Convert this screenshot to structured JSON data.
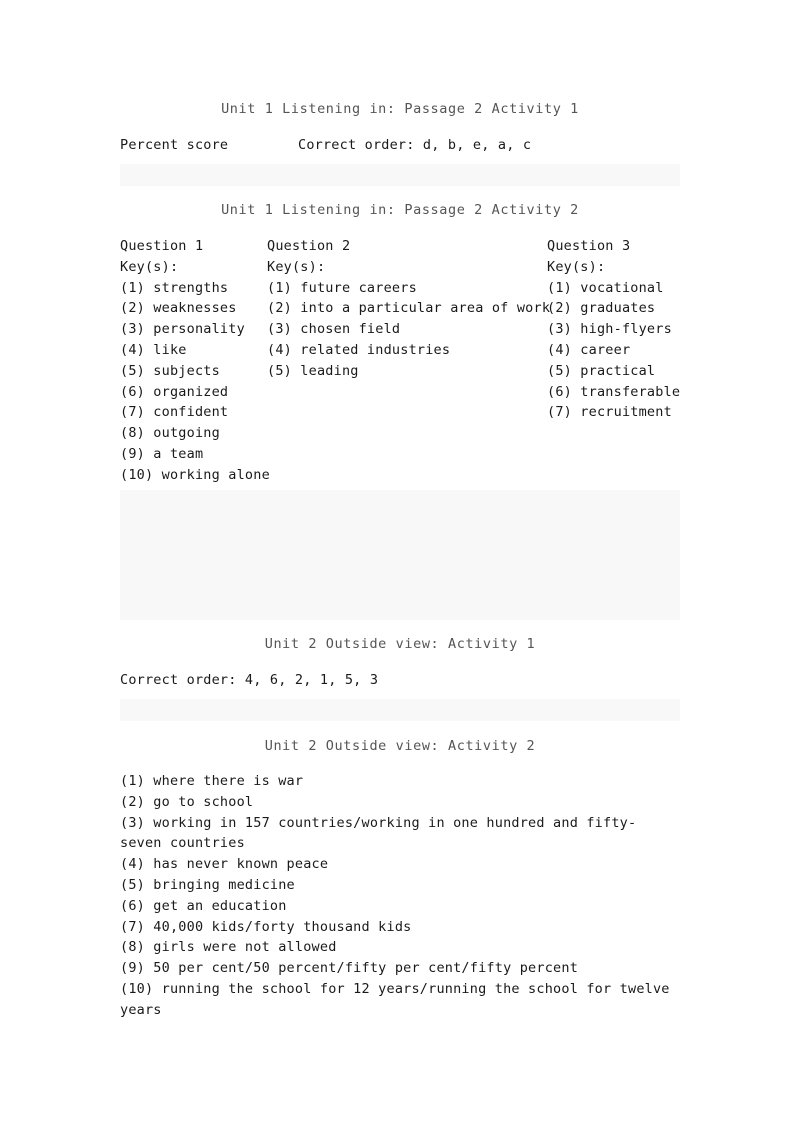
{
  "document": {
    "sections": [
      {
        "id": "unit1-activity1",
        "heading": "Unit 1 Listening in: Passage 2 Activity 1",
        "label_left": "Percent score",
        "label_right": "Correct order: d, b, e, a, c"
      },
      {
        "id": "unit1-activity2",
        "heading": "Unit 1 Listening in: Passage 2 Activity 2",
        "columns": [
          {
            "title": "Question 1",
            "keys_label": "Key(s):",
            "items": [
              "(1) strengths",
              "(2) weaknesses",
              "(3) personality",
              "(4) like",
              "(5) subjects",
              "(6) organized",
              "(7) confident",
              "(8) outgoing",
              "(9) a team",
              "(10) working alone"
            ]
          },
          {
            "title": "Question 2",
            "keys_label": "Key(s):",
            "items": [
              "(1) future careers",
              "(2) into a particular area of work",
              "(3) chosen field",
              "(4) related industries",
              "(5) leading"
            ]
          },
          {
            "title": "Question 3",
            "keys_label": "Key(s):",
            "items": [
              "(1) vocational",
              "(2) graduates",
              "(3) high-flyers",
              "(4) career",
              "(5) practical",
              "(6) transferable",
              "(7) recruitment"
            ]
          }
        ]
      },
      {
        "id": "unit2-activity1",
        "heading": "Unit 2 Outside view: Activity 1",
        "correct_order": "Correct order: 4, 6, 2, 1, 5, 3"
      },
      {
        "id": "unit2-activity2",
        "heading": "Unit 2 Outside view: Activity 2",
        "items": [
          "(1) where there is war",
          "(2) go to school",
          "(3) working in 157 countries/working in one hundred and fifty-seven countries",
          "(4) has never known peace",
          "(5) bringing medicine",
          "(6) get an education",
          "(7) 40,000 kids/forty thousand kids",
          "(8) girls were not allowed",
          "(9) 50 per cent/50 percent/fifty per cent/fifty percent",
          "(10) running the school for 12 years/running the school for twelve years"
        ]
      }
    ]
  },
  "colors": {
    "page_background": "#ffffff",
    "heading_text": "#555555",
    "body_text": "#1a1a1a",
    "gray_band": "#f8f8f8"
  }
}
